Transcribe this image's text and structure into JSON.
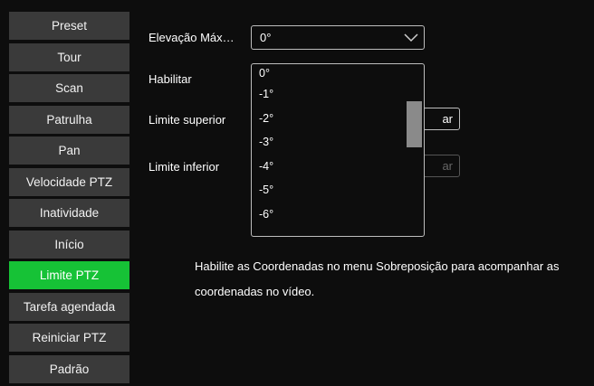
{
  "sidebar": {
    "items": [
      {
        "label": "Preset"
      },
      {
        "label": "Tour"
      },
      {
        "label": "Scan"
      },
      {
        "label": "Patrulha"
      },
      {
        "label": "Pan"
      },
      {
        "label": "Velocidade PTZ"
      },
      {
        "label": "Inatividade"
      },
      {
        "label": "Início"
      },
      {
        "label": "Limite PTZ",
        "active": true
      },
      {
        "label": "Tarefa agendada"
      },
      {
        "label": "Reiniciar PTZ"
      },
      {
        "label": "Padrão"
      }
    ]
  },
  "form": {
    "elevation_label": "Elevação Máx…",
    "elevation_value": "0°",
    "enable_label": "Habilitar",
    "upper_limit_label": "Limite superior",
    "lower_limit_label": "Limite inferior",
    "upper_button_partial": "ar",
    "lower_button_partial": "ar"
  },
  "dropdown": {
    "options": [
      "0°",
      "-1°",
      "-2°",
      "-3°",
      "-4°",
      "-5°",
      "-6°"
    ]
  },
  "hint": {
    "text": "Habilite as Coordenadas no menu Sobreposição para acompanhar as coordenadas no vídeo."
  },
  "colors": {
    "active": "#16c236",
    "nav_bg": "#3a3a3a",
    "page_bg": "#0d0d0d",
    "scrollbar": "#8a8a8a"
  }
}
